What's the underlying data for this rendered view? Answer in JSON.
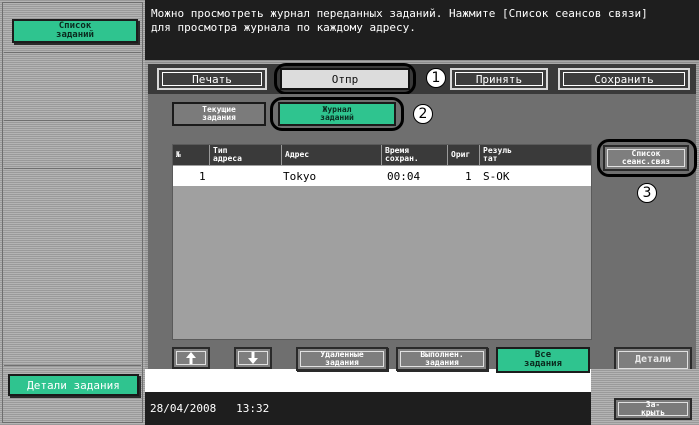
{
  "sidebar": {
    "job_list_label": "Список\nзаданий",
    "job_details_label": "Детали задания"
  },
  "message": {
    "text": "Можно просмотреть журнал переданных заданий. Нажмите [Список сеансов связи]\nдля просмотра журнала по каждому адресу."
  },
  "tabs": [
    {
      "label": "Печать"
    },
    {
      "label": "Отпр"
    },
    {
      "label": "Принять"
    },
    {
      "label": "Сохранить"
    }
  ],
  "subtabs": {
    "current_label": "Текущие\nзадания",
    "log_label": "Журнал\nзаданий"
  },
  "table": {
    "headers": [
      "№",
      "Тип\nадреса",
      "Адрес",
      "Время\nсохран.",
      "Ориг",
      "Резуль\nтат"
    ],
    "rows": [
      {
        "no": "1",
        "type": "",
        "address": "Tokyo",
        "time": "00:04",
        "orig": "1",
        "result": "S-OK"
      }
    ]
  },
  "filters": {
    "deleted_label": "Удаленные\nзадания",
    "done_label": "Выполнен.\nзадания",
    "all_label": "Все\nзадания"
  },
  "right": {
    "session_list_label": "Список\nсеанс.связ",
    "details_label": "Детали",
    "close_label": "За-\nкрыть"
  },
  "status": {
    "datetime": "28/04/2008   13:32"
  },
  "callouts": [
    "1",
    "2",
    "3"
  ],
  "icons": {
    "up": "arrow-up-icon",
    "down": "arrow-down-icon"
  },
  "colors": {
    "accent_green": "#2fc48f",
    "dark_bar": "#1e1e1e"
  }
}
